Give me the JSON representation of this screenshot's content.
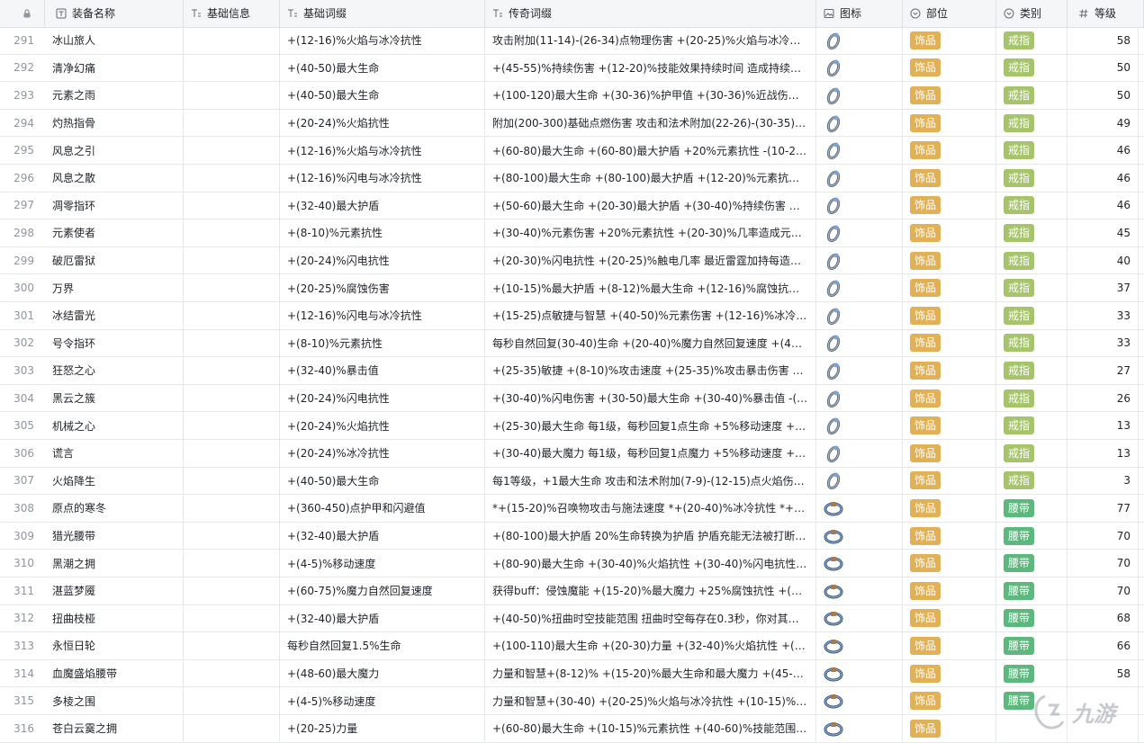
{
  "columns": {
    "lock": "",
    "name": "装备名称",
    "base": "基础信息",
    "affix": "基础词缀",
    "legend": "传奇词缀",
    "icon": "图标",
    "slot": "部位",
    "type": "类别",
    "level": "等级"
  },
  "colors": {
    "accessory_tag": "#e3b155",
    "ring_tag": "#a6c46a",
    "belt_tag": "#5cb87c"
  },
  "rows": [
    {
      "idx": "291",
      "name": "冰山旅人",
      "base": "",
      "affix": "+(12-16)%火焰与冰冷抗性",
      "legend": "攻击附加(11-14)-(26-34)点物理伤害 +(20-25)%火焰与冰冷抗性 +(...",
      "icon": "ring-icon",
      "slot": "饰品",
      "type": "戒指",
      "level": "58"
    },
    {
      "idx": "292",
      "name": "清净幻痛",
      "base": "",
      "affix": "+(40-50)最大生命",
      "legend": "+(45-55)%持续伤害 +(12-20)%技能效果持续时间 造成持续伤害时...",
      "icon": "ring-icon",
      "slot": "饰品",
      "type": "戒指",
      "level": "50"
    },
    {
      "idx": "293",
      "name": "元素之雨",
      "base": "",
      "affix": "+(40-50)最大生命",
      "legend": "+(100-120)最大生命 +(30-36)%护甲值 +(30-36)%近战伤害 每有1...",
      "icon": "ring-icon",
      "slot": "饰品",
      "type": "戒指",
      "level": "50"
    },
    {
      "idx": "294",
      "name": "灼热指骨",
      "base": "",
      "affix": "+(20-24)%火焰抗性",
      "legend": "附加(200-300)基础点燃伤害 攻击和法术附加(22-26)-(30-35)点火焰...",
      "icon": "ring-icon",
      "slot": "饰品",
      "type": "戒指",
      "level": "49"
    },
    {
      "idx": "295",
      "name": "风息之引",
      "base": "",
      "affix": "+(12-16)%火焰与冰冷抗性",
      "legend": "+(60-80)最大生命 +(60-80)最大护盾 +20%元素抗性 -(10-20)%移...",
      "icon": "ring-icon",
      "slot": "饰品",
      "type": "戒指",
      "level": "46"
    },
    {
      "idx": "296",
      "name": "风息之散",
      "base": "",
      "affix": "+(12-16)%闪电与冰冷抗性",
      "legend": "+(80-100)最大生命 +(80-100)最大护盾 +(12-20)%元素抗性 -20%...",
      "icon": "ring-icon",
      "slot": "饰品",
      "type": "戒指",
      "level": "46"
    },
    {
      "idx": "297",
      "name": "凋零指环",
      "base": "",
      "affix": "+(32-40)最大护盾",
      "legend": "+(50-60)最大生命 +(20-30)最大护盾 +(30-40)%持续伤害 +(10-50)...",
      "icon": "ring-icon",
      "slot": "饰品",
      "type": "戒指",
      "level": "46"
    },
    {
      "idx": "298",
      "name": "元素使者",
      "base": "",
      "affix": "+(8-10)%元素抗性",
      "legend": "+(30-40)%元素伤害 +20%元素抗性 +(20-30)%几率造成元素异常...",
      "icon": "ring-icon",
      "slot": "饰品",
      "type": "戒指",
      "level": "45"
    },
    {
      "idx": "299",
      "name": "破厄雷狱",
      "base": "",
      "affix": "+(20-24)%闪电抗性",
      "legend": "+(20-30)%闪电抗性 +(20-25)%触电几率 最近雷霆加持每造成一次...",
      "icon": "ring-icon",
      "slot": "饰品",
      "type": "戒指",
      "level": "40"
    },
    {
      "idx": "300",
      "name": "万界",
      "base": "",
      "affix": "+(20-25)%腐蚀伤害",
      "legend": "+(10-15)%最大护盾 +(8-12)%最大生命 +(12-16)%腐蚀抗性 附加(8...",
      "icon": "ring-icon",
      "slot": "饰品",
      "type": "戒指",
      "level": "37"
    },
    {
      "idx": "301",
      "name": "冰结雷光",
      "base": "",
      "affix": "+(12-16)%闪电与冰冷抗性",
      "legend": "+(15-25)点敏捷与智慧 +(40-50)%元素伤害 +(12-16)%冰冷与闪电...",
      "icon": "ring-icon",
      "slot": "饰品",
      "type": "戒指",
      "level": "33"
    },
    {
      "idx": "302",
      "name": "号令指环",
      "base": "",
      "affix": "+(8-10)%元素抗性",
      "legend": "每秒自然回复(30-40)生命 +(20-40)%魔力自然回复速度 +(40-50)%...",
      "icon": "ring-icon",
      "slot": "饰品",
      "type": "戒指",
      "level": "33"
    },
    {
      "idx": "303",
      "name": "狂怒之心",
      "base": "",
      "affix": "+(32-40)%暴击值",
      "legend": "+(25-35)敏捷 +(8-10)%攻击速度 +(25-35)%攻击暴击伤害 暴击时...",
      "icon": "ring-icon",
      "slot": "饰品",
      "type": "戒指",
      "level": "27"
    },
    {
      "idx": "304",
      "name": "黑云之簇",
      "base": "",
      "affix": "+(20-24)%闪电抗性",
      "legend": "+(30-40)%闪电伤害 +(30-50)最大生命 +(30-40)%暴击值 -(30-40)%...",
      "icon": "ring-icon",
      "slot": "饰品",
      "type": "戒指",
      "level": "26"
    },
    {
      "idx": "305",
      "name": "机械之心",
      "base": "",
      "affix": "+(20-24)%火焰抗性",
      "legend": "+(25-30)最大生命 每1级，每秒回复1点生命 +5%移动速度 +5%攻...",
      "icon": "ring-icon",
      "slot": "饰品",
      "type": "戒指",
      "level": "13"
    },
    {
      "idx": "306",
      "name": "谎言",
      "base": "",
      "affix": "+(20-24)%冰冷抗性",
      "legend": "+(30-40)最大魔力 每1级，每秒回复1点魔力 +5%移动速度 +5%施...",
      "icon": "ring-icon",
      "slot": "饰品",
      "type": "戒指",
      "level": "13"
    },
    {
      "idx": "307",
      "name": "火焰降生",
      "base": "",
      "affix": "+(40-50)最大生命",
      "legend": "每1等级，+1最大生命 攻击和法术附加(7-9)-(12-15)点火焰伤害 +(...",
      "icon": "ring-icon",
      "slot": "饰品",
      "type": "戒指",
      "level": "3"
    },
    {
      "idx": "308",
      "name": "原点的寒冬",
      "base": "",
      "affix": "+(360-450)点护甲和闪避值",
      "legend": "*+(15-20)%召唤物攻击与施法速度 *+(20-40)%冰冷抗性 *+(8-12)%...",
      "icon": "belt-icon",
      "slot": "饰品",
      "type": "腰带",
      "level": "77"
    },
    {
      "idx": "309",
      "name": "猎光腰带",
      "base": "",
      "affix": "+(32-40)最大护盾",
      "legend": "+(80-100)最大护盾 20%生命转换为护盾 护盾充能无法被打断 当前...",
      "icon": "belt-icon",
      "slot": "饰品",
      "type": "腰带",
      "level": "70"
    },
    {
      "idx": "310",
      "name": "黑潮之拥",
      "base": "",
      "affix": "+(4-5)%移动速度",
      "legend": "+(80-90)最大生命 +(30-40)%火焰抗性 +(30-40)%闪电抗性 被触电...",
      "icon": "belt-icon",
      "slot": "饰品",
      "type": "腰带",
      "level": "70"
    },
    {
      "idx": "311",
      "name": "湛蓝梦魇",
      "base": "",
      "affix": "+(60-75)%魔力自然回复速度",
      "legend": "获得buff：侵蚀魔能 +(15-20)%最大魔力 +25%腐蚀抗性 +(40-60)...",
      "icon": "belt-icon",
      "slot": "饰品",
      "type": "腰带",
      "level": "70"
    },
    {
      "idx": "312",
      "name": "扭曲枝桠",
      "base": "",
      "affix": "+(32-40)最大护盾",
      "legend": "+(40-50)%扭曲时空技能范围 扭曲时空每存在0.3秒，你对其内的敌...",
      "icon": "belt-icon",
      "slot": "饰品",
      "type": "腰带",
      "level": "68"
    },
    {
      "idx": "313",
      "name": "永恒日轮",
      "base": "",
      "affix": "每秒自然回复1.5%生命",
      "legend": "+(100-110)最大生命 +(20-30)力量 +(32-40)%火焰抗性 +(64-83)%...",
      "icon": "belt-icon",
      "slot": "饰品",
      "type": "腰带",
      "level": "66"
    },
    {
      "idx": "314",
      "name": "血魔盛焰腰带",
      "base": "",
      "affix": "+(48-60)最大魔力",
      "legend": "力量和智慧+(8-12)% +(15-20)%最大生命和最大魔力 +(45-55)%...",
      "icon": "belt-icon",
      "slot": "饰品",
      "type": "腰带",
      "level": "58"
    },
    {
      "idx": "315",
      "name": "多棱之围",
      "base": "",
      "affix": "+(4-5)%移动速度",
      "legend": "力量和智慧+(30-40) +(20-25)%火焰与冰冷抗性 +(10-15)%攻击与...",
      "icon": "belt-icon",
      "slot": "饰品",
      "type": "腰带",
      "level": ""
    },
    {
      "idx": "316",
      "name": "苍白云霙之拥",
      "base": "",
      "affix": "+(20-25)力量",
      "legend": "+(60-80)最大生命 +(10-15)%元素抗性 +(40-60)%技能范围 技能范...",
      "icon": "belt-icon",
      "slot": "饰品",
      "type": "",
      "level": ""
    }
  ],
  "watermark": {
    "logo": "9game-logo",
    "text": "九游"
  }
}
